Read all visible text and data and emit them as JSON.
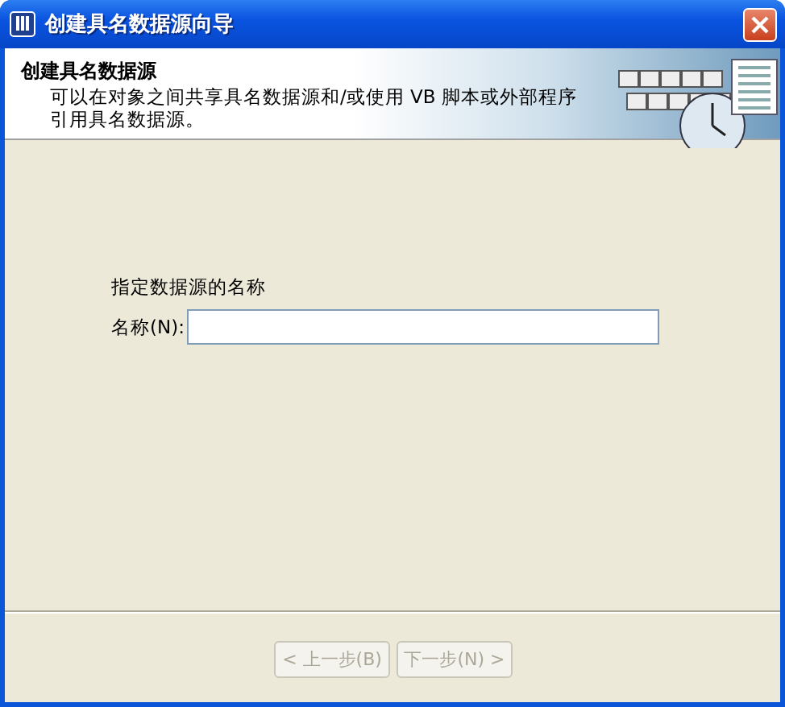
{
  "window": {
    "title": "创建具名数据源向导"
  },
  "header": {
    "title": "创建具名数据源",
    "description": "可以在对象之间共享具名数据源和/或使用 VB 脚本或外部程序引用具名数据源。"
  },
  "form": {
    "instruction": "指定数据源的名称",
    "name_label": "名称(N):"
  },
  "buttons": [
    {
      "label": "< 上一步(B)",
      "disabled": true
    },
    {
      "label": "下一步(N) >",
      "disabled": true
    }
  ]
}
